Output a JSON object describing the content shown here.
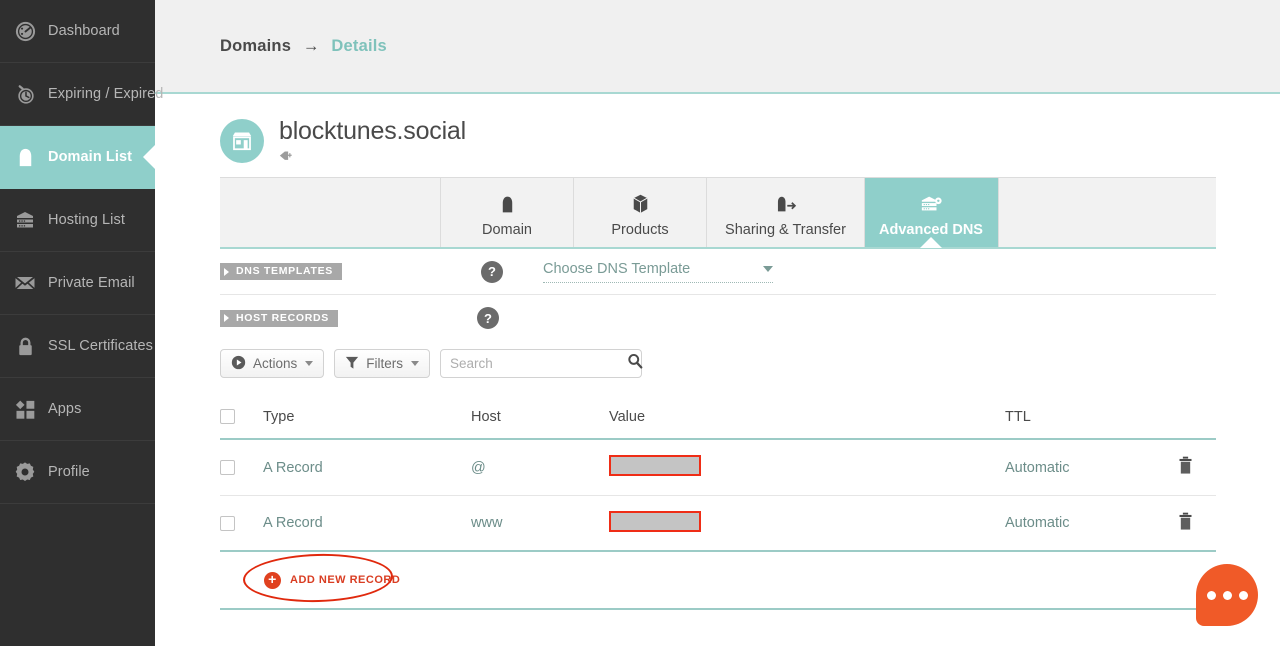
{
  "sidebar": {
    "items": [
      {
        "label": "Dashboard",
        "icon": "gauge-icon",
        "active": false
      },
      {
        "label": "Expiring / Expired",
        "icon": "clock-icon",
        "active": false
      },
      {
        "label": "Domain List",
        "icon": "home-icon",
        "active": true
      },
      {
        "label": "Hosting List",
        "icon": "server-icon",
        "active": false
      },
      {
        "label": "Private Email",
        "icon": "envelope-icon",
        "active": false
      },
      {
        "label": "SSL Certificates",
        "icon": "lock-icon",
        "active": false
      },
      {
        "label": "Apps",
        "icon": "apps-grid-icon",
        "active": false
      },
      {
        "label": "Profile",
        "icon": "gear-icon",
        "active": false
      }
    ]
  },
  "breadcrumb": {
    "root": "Domains",
    "separator": "→",
    "leaf": "Details"
  },
  "domain": {
    "name": "blocktunes.social",
    "avatar_icon": "storefront-icon",
    "tag_icon": "tag-plus-icon"
  },
  "tabs": [
    {
      "label": "Domain",
      "icon": "home-icon",
      "active": false
    },
    {
      "label": "Products",
      "icon": "box-icon",
      "active": false
    },
    {
      "label": "Sharing & Transfer",
      "icon": "share-icon",
      "active": false
    },
    {
      "label": "Advanced DNS",
      "icon": "server-icon",
      "active": true
    }
  ],
  "sections": {
    "dns_templates": {
      "label": "DNS TEMPLATES",
      "help": "?",
      "template_select_value": "Choose DNS Template"
    },
    "host_records": {
      "label": "HOST RECORDS",
      "help": "?"
    }
  },
  "toolbar": {
    "actions_label": "Actions",
    "filters_label": "Filters",
    "search_placeholder": "Search",
    "search_value": ""
  },
  "table": {
    "headers": [
      "Type",
      "Host",
      "Value",
      "TTL"
    ],
    "rows": [
      {
        "type": "A Record",
        "host": "@",
        "value": "",
        "value_redacted": true,
        "ttl": "Automatic",
        "delete_icon": "trash-icon"
      },
      {
        "type": "A Record",
        "host": "www",
        "value": "",
        "value_redacted": true,
        "ttl": "Automatic",
        "delete_icon": "trash-icon"
      }
    ],
    "add_record_label": "ADD NEW RECORD",
    "add_record_icon": "plus-circle-icon"
  },
  "chat_fab": {
    "icon": "chat-bubble-icon",
    "dots": 3
  },
  "colors": {
    "accent_teal": "#8fcfca",
    "sidebar_dark": "#2f2f2f",
    "annotation_red": "#e0290d",
    "redaction_border": "#ef2d16",
    "fab_orange": "#f05a28"
  }
}
